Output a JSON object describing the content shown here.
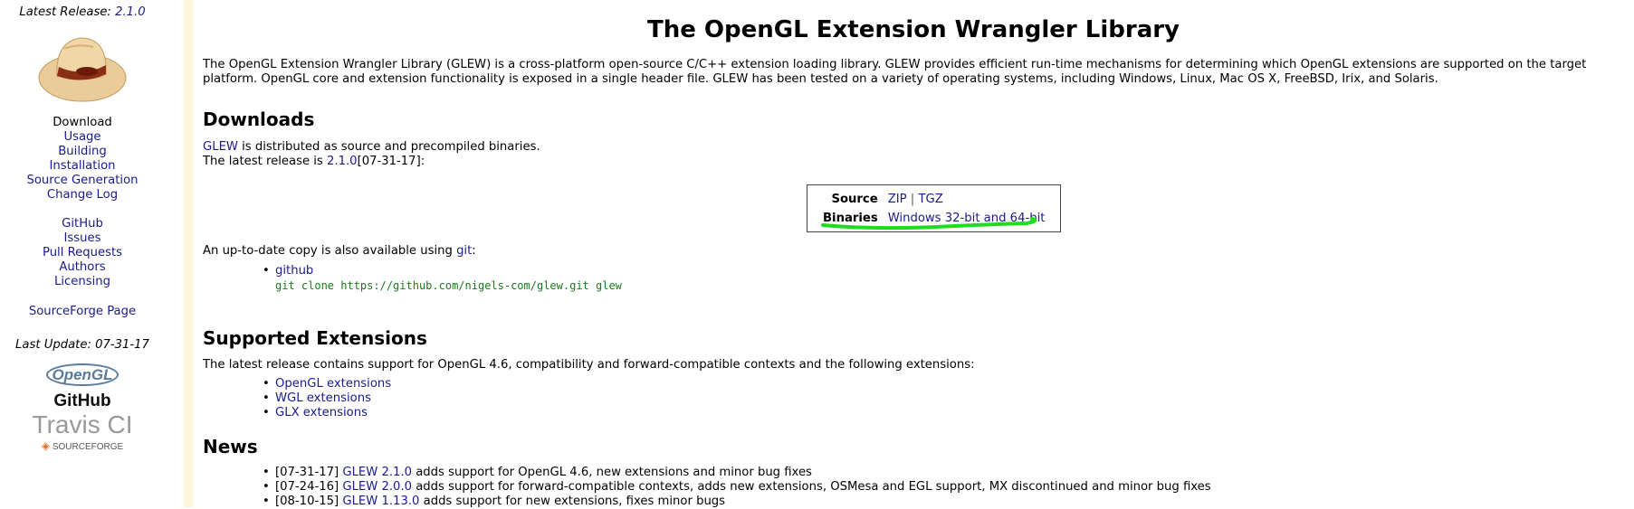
{
  "sidebar": {
    "latest_release_label": "Latest Release:",
    "latest_release_version": "2.1.0",
    "nav_group_1": [
      {
        "label": "Download",
        "link": false
      },
      {
        "label": "Usage",
        "link": true
      },
      {
        "label": "Building",
        "link": true
      },
      {
        "label": "Installation",
        "link": true
      },
      {
        "label": "Source Generation",
        "link": true
      },
      {
        "label": "Change Log",
        "link": true
      }
    ],
    "nav_group_2": [
      {
        "label": "GitHub",
        "link": true
      },
      {
        "label": "Issues",
        "link": true
      },
      {
        "label": "Pull Requests",
        "link": true
      },
      {
        "label": "Authors",
        "link": true
      },
      {
        "label": "Licensing",
        "link": true
      }
    ],
    "sourceforge_page": "SourceForge Page",
    "last_update": "Last Update: 07-31-17",
    "logos": {
      "opengl": "OpenGL",
      "github": "GitHub",
      "travis": "Travis CI",
      "sourceforge": "SOURCEFORGE"
    }
  },
  "main": {
    "title": "The OpenGL Extension Wrangler Library",
    "intro_line_1": "The OpenGL Extension Wrangler Library (GLEW) is a cross-platform open-source C/C++ extension loading library. GLEW provides efficient run-time mechanisms for determining which OpenGL extensions are supported on the target",
    "intro_line_2": "platform. OpenGL core and extension functionality is exposed in a single header file. GLEW has been tested on a variety of operating systems, including Windows, Linux, Mac OS X, FreeBSD, Irix, and Solaris.",
    "downloads": {
      "heading": "Downloads",
      "glew_link": "GLEW",
      "distributed_text": " is distributed as source and precompiled binaries.",
      "latest_prefix": "The latest release is ",
      "latest_version_link": "2.1.0",
      "latest_suffix": "[07-31-17]:",
      "table": {
        "source_label": "Source",
        "zip": "ZIP",
        "separator": "|",
        "tgz": "TGZ",
        "binaries_label": "Binaries",
        "binaries_link": "Windows 32-bit and 64-bit"
      },
      "git_prefix": "An up-to-date copy is also available using ",
      "git_link": "git",
      "git_suffix": ":",
      "github_link": "github",
      "clone_command": "git clone https://github.com/nigels-com/glew.git glew"
    },
    "extensions": {
      "heading": "Supported Extensions",
      "description": "The latest release contains support for OpenGL 4.6, compatibility and forward-compatible contexts and the following extensions:",
      "items": [
        "OpenGL extensions",
        "WGL extensions",
        "GLX extensions"
      ]
    },
    "news": {
      "heading": "News",
      "items": [
        {
          "date": "[07-31-17] ",
          "link": "GLEW 2.1.0",
          "text": " adds support for OpenGL 4.6, new extensions and minor bug fixes"
        },
        {
          "date": "[07-24-16] ",
          "link": "GLEW 2.0.0",
          "text": " adds support for forward-compatible contexts, adds new extensions, OSMesa and EGL support, MX discontinued and minor bug fixes"
        },
        {
          "date": "[08-10-15] ",
          "link": "GLEW 1.13.0",
          "text": " adds support for new extensions, fixes minor bugs"
        }
      ]
    }
  },
  "colors": {
    "link": "#1a1a8c",
    "highlight_underline": "#1fdc1f",
    "code": "#1a7a1a",
    "sidebar_stripe": "#fdf5dc"
  }
}
